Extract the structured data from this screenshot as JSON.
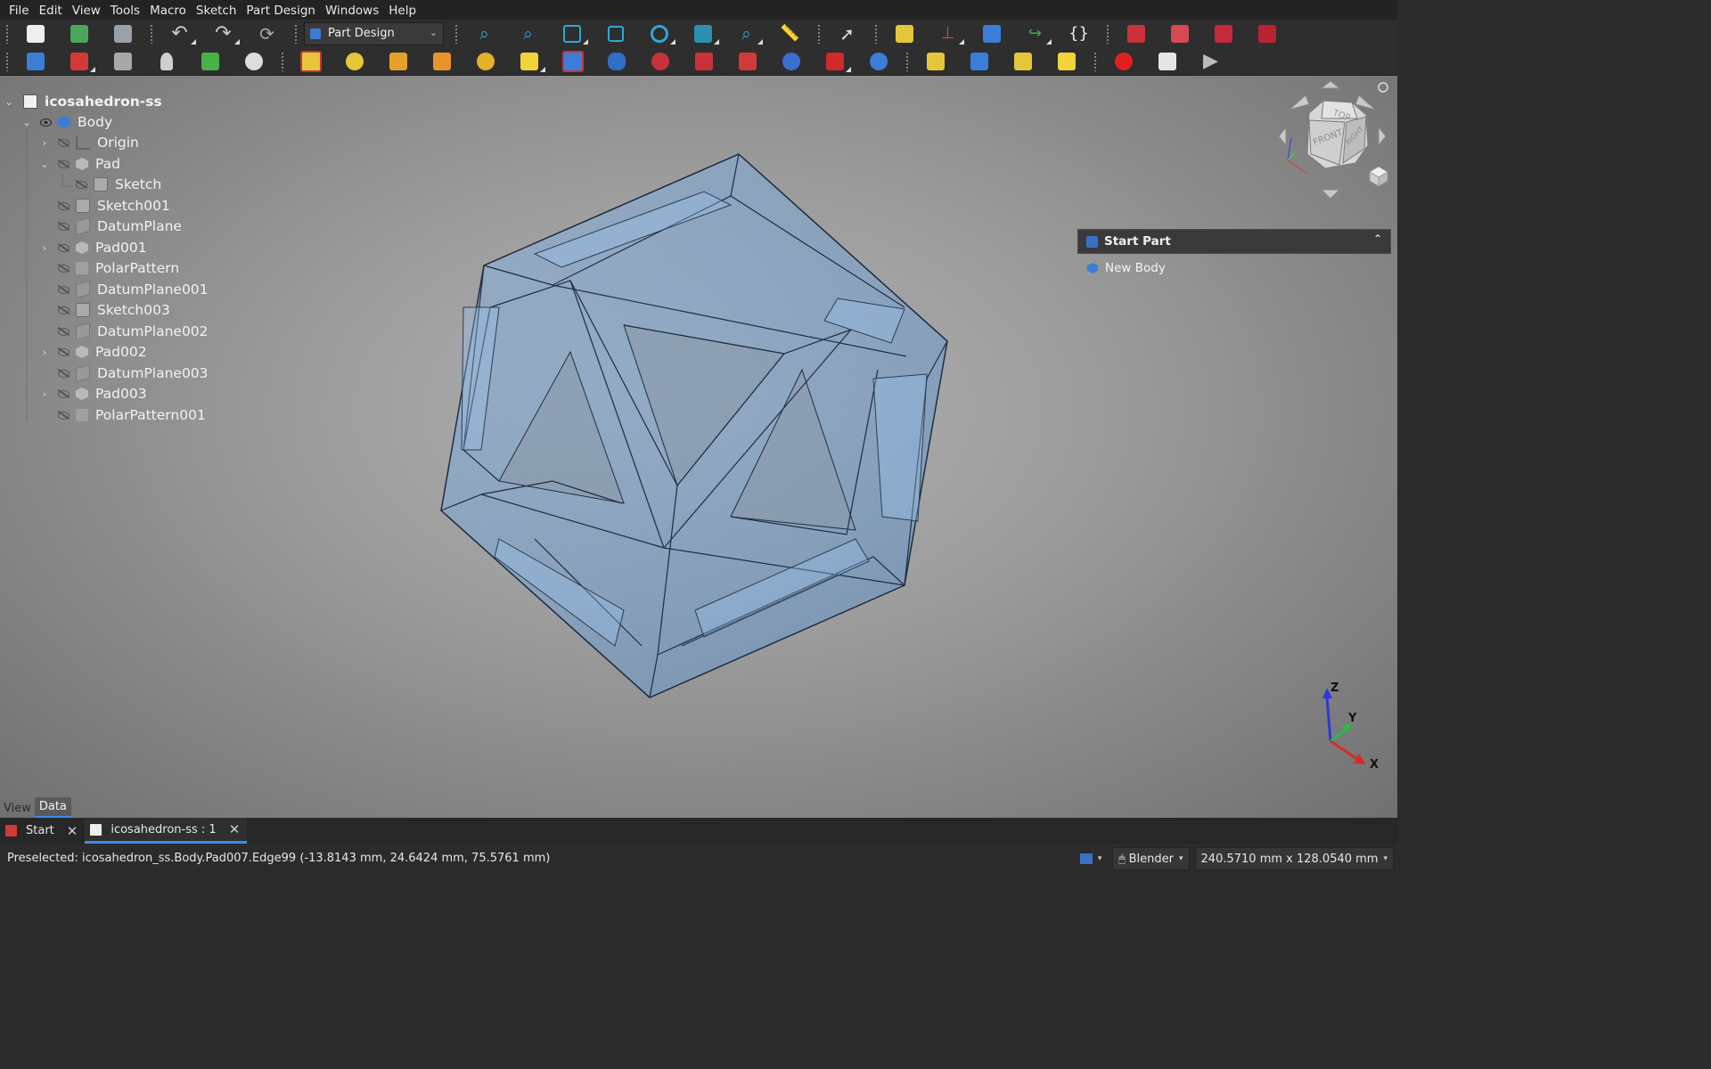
{
  "menu": [
    "File",
    "Edit",
    "View",
    "Tools",
    "Macro",
    "Sketch",
    "Part Design",
    "Windows",
    "Help"
  ],
  "toolbar": {
    "workbench": "Part Design"
  },
  "tree": {
    "items": [
      {
        "label": "icosahedron-ss",
        "icon": "document-icon"
      },
      {
        "label": "Body",
        "icon": "body-icon"
      },
      {
        "label": "Origin",
        "icon": "origin-icon"
      },
      {
        "label": "Pad",
        "icon": "pad-icon"
      },
      {
        "label": "Sketch",
        "icon": "sketch-icon"
      },
      {
        "label": "Sketch001",
        "icon": "sketch-icon"
      },
      {
        "label": "DatumPlane",
        "icon": "datum-plane-icon"
      },
      {
        "label": "Pad001",
        "icon": "pad-icon"
      },
      {
        "label": "PolarPattern",
        "icon": "polar-pattern-icon"
      },
      {
        "label": "DatumPlane001",
        "icon": "datum-plane-icon"
      },
      {
        "label": "Sketch003",
        "icon": "sketch-icon"
      },
      {
        "label": "DatumPlane002",
        "icon": "datum-plane-icon"
      },
      {
        "label": "Pad002",
        "icon": "pad-icon"
      },
      {
        "label": "DatumPlane003",
        "icon": "datum-plane-icon"
      },
      {
        "label": "Pad003",
        "icon": "pad-icon"
      },
      {
        "label": "PolarPattern001",
        "icon": "polar-pattern-icon"
      }
    ]
  },
  "navcube": {
    "top": "TOP",
    "front": "FRONT",
    "right": "RIGHT"
  },
  "task_panel": {
    "title": "Start Part",
    "item": "New Body"
  },
  "axis": {
    "z": "Z",
    "y": "Y",
    "x": "X"
  },
  "combo_tabs": [
    "View",
    "Data"
  ],
  "doc_tabs": [
    {
      "label": "Start"
    },
    {
      "label": "icosahedron-ss : 1"
    }
  ],
  "status": {
    "text": "Preselected: icosahedron_ss.Body.Pad007.Edge99 (-13.8143 mm, 24.6424 mm, 75.5761 mm)",
    "navigation": "Blender",
    "dimensions": "240.5710 mm x 128.0540 mm"
  },
  "colors": {
    "accent": "#3a8ee6",
    "model_fill": "#6e9fd4",
    "model_edge": "#1e2d40"
  }
}
